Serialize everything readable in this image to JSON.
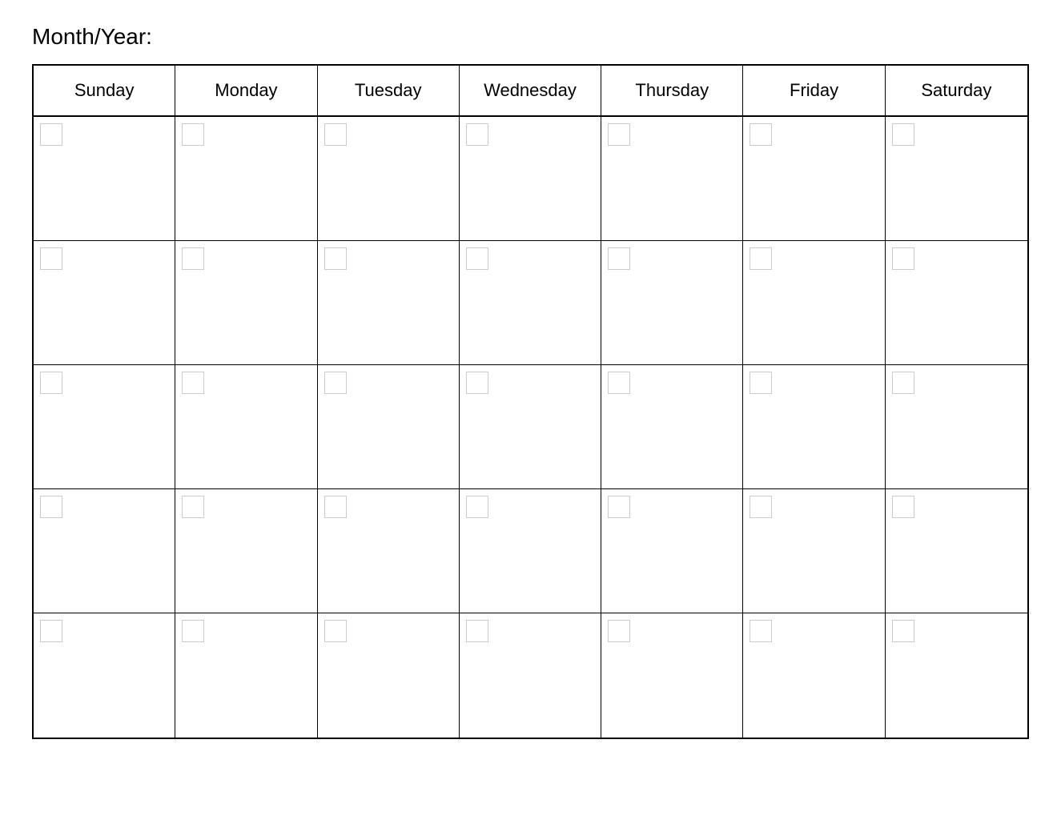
{
  "header": {
    "month_year_label": "Month/Year:"
  },
  "calendar": {
    "days": [
      {
        "label": "Sunday"
      },
      {
        "label": "Monday"
      },
      {
        "label": "Tuesday"
      },
      {
        "label": "Wednesday"
      },
      {
        "label": "Thursday"
      },
      {
        "label": "Friday"
      },
      {
        "label": "Saturday"
      }
    ],
    "weeks": 5,
    "cells_per_week": 7
  }
}
